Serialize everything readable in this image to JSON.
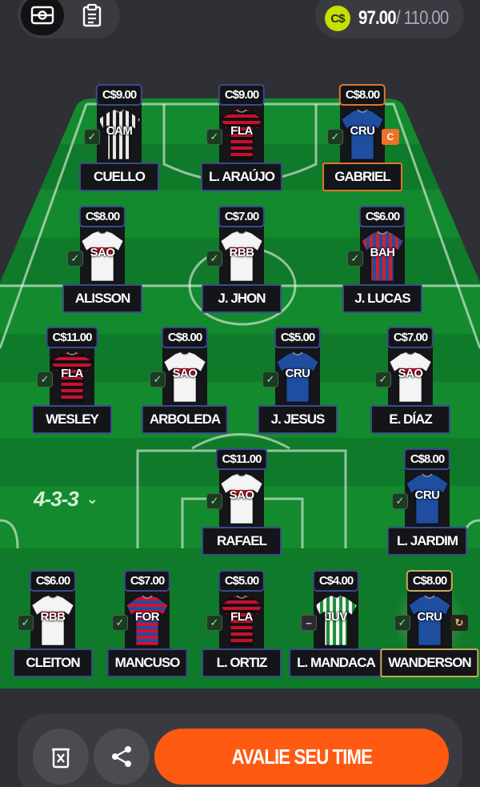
{
  "topbar": {
    "field_view_icon": "soccer-field-icon",
    "list_view_icon": "clipboard-icon",
    "currency": "C$",
    "budget_used": "97.00",
    "budget_total": "/ 110.00"
  },
  "formation": {
    "label": "4-3-3",
    "chevron": "⌄"
  },
  "starters": [
    {
      "price": "C$9.00",
      "club": "CAM",
      "name": "CUELLO",
      "status": "✓",
      "captain": false
    },
    {
      "price": "C$9.00",
      "club": "FLA",
      "name": "L. ARAÚJO",
      "status": "✓",
      "captain": false
    },
    {
      "price": "C$8.00",
      "club": "CRU",
      "name": "GABRIEL",
      "status": "✓",
      "captain": true,
      "badge": "C"
    },
    {
      "price": "C$8.00",
      "club": "SAO",
      "name": "ALISSON",
      "status": "✓"
    },
    {
      "price": "C$7.00",
      "club": "RBB",
      "name": "J. JHON",
      "status": "✓"
    },
    {
      "price": "C$6.00",
      "club": "BAH",
      "name": "J. LUCAS",
      "status": "✓"
    },
    {
      "price": "C$11.00",
      "club": "FLA",
      "name": "WESLEY",
      "status": "✓"
    },
    {
      "price": "C$8.00",
      "club": "SAO",
      "name": "ARBOLEDA",
      "status": "✓"
    },
    {
      "price": "C$5.00",
      "club": "CRU",
      "name": "J. JESUS",
      "status": "✓"
    },
    {
      "price": "C$7.00",
      "club": "SAO",
      "name": "E. DÍAZ",
      "status": "✓"
    },
    {
      "price": "C$11.00",
      "club": "SAO",
      "name": "RAFAEL",
      "status": "✓"
    },
    {
      "price": "C$8.00",
      "club": "CRU",
      "name": "L. JARDIM",
      "status": "✓"
    }
  ],
  "bench": [
    {
      "price": "C$6.00",
      "club": "RBB",
      "name": "CLEITON",
      "status": "✓"
    },
    {
      "price": "C$7.00",
      "club": "FOR",
      "name": "MANCUSO",
      "status": "✓"
    },
    {
      "price": "C$5.00",
      "club": "FLA",
      "name": "L. ORTIZ",
      "status": "✓"
    },
    {
      "price": "C$4.00",
      "club": "JUV",
      "name": "L. MANDACA",
      "status": "−"
    },
    {
      "price": "C$8.00",
      "club": "CRU",
      "name": "WANDERSON",
      "status": "✓",
      "badge": "↻"
    }
  ],
  "footer": {
    "delete_icon": "trash-icon",
    "share_icon": "share-icon",
    "cta_label": "AVALIE SEU TIME"
  },
  "colors": {
    "pitch_dark": "#0f7a2a",
    "pitch_light": "#16962f",
    "accent_orange": "#ff5a12",
    "budget_coin": "#c6e000"
  }
}
